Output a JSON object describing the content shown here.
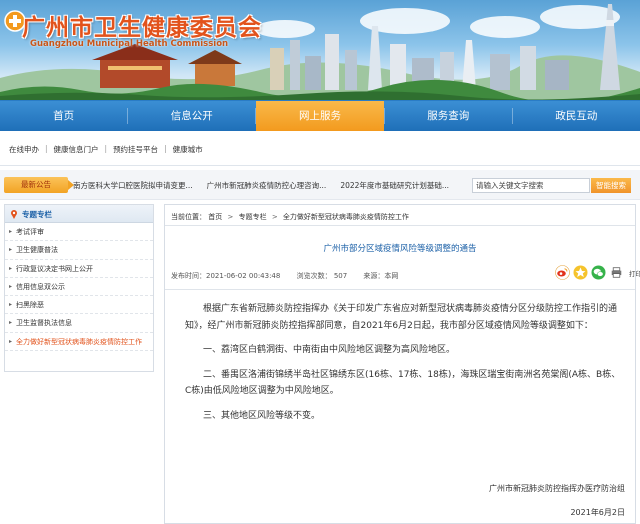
{
  "header": {
    "title": "广州市卫生健康委员会",
    "title_en": "Guangzhou Municipal Health Commission"
  },
  "nav": {
    "items": [
      "首页",
      "信息公开",
      "网上服务",
      "服务查询",
      "政民互动"
    ],
    "active": "网上服务"
  },
  "subnav": {
    "items": [
      "在线申办",
      "健康信息门户",
      "预约挂号平台",
      "健康城市"
    ]
  },
  "notice": {
    "label": "最新公告",
    "items": [
      "南方医科大学口腔医院拟申请变更...",
      "广州市新冠肺炎疫情防控心理咨询...",
      "2022年度市基础研究计划基础..."
    ]
  },
  "search": {
    "value": "请输入关键文字搜索",
    "button": "智能搜索"
  },
  "sidebar": {
    "title": "专题专栏",
    "items": [
      "考试评审",
      "卫生健康普法",
      "行政复议决定书网上公开",
      "信用信息双公示",
      "扫黑除恶",
      "卫生监督执法信息",
      "全力做好新型冠状病毒肺炎疫情防控工作"
    ]
  },
  "article": {
    "breadcrumb": [
      "当前位置：",
      "首页",
      "专题专栏",
      "全力做好新型冠状病毒肺炎疫情防控工作"
    ],
    "title": "广州市部分区域疫情风险等级调整的通告",
    "meta": {
      "publish_time": "发布时间：2021-06-02 00:43:48",
      "views": "浏览次数：  507",
      "source": "来源：本网"
    },
    "print_label": "打印此文",
    "paragraphs": [
      "根据广东省新冠肺炎防控指挥办《关于印发广东省应对新型冠状病毒肺炎疫情分区分级防控工作指引的通知》，经广州市新冠肺炎防控指挥部同意，自2021年6月2日起，我市部分区域疫情风险等级调整如下：",
      "一、荔湾区白鹤洞街、中南街由中风险地区调整为高风险地区。",
      "二、番禺区洛浦街锦绣半岛社区锦绣东区(16栋、17栋、18栋)，海珠区瑞宝街南洲名苑棠阁(A栋、B栋、C栋)由低风险地区调整为中风险地区。",
      "三、其他地区风险等级不变。"
    ],
    "signature": "广州市新冠肺炎防控指挥办医疗防治组",
    "date": "2021年6月2日"
  },
  "colors": {
    "nav_blue": "#1f6fb8",
    "nav_active": "#f39a1e",
    "title_orange": "#e2531c",
    "link_blue": "#1e62a8"
  }
}
